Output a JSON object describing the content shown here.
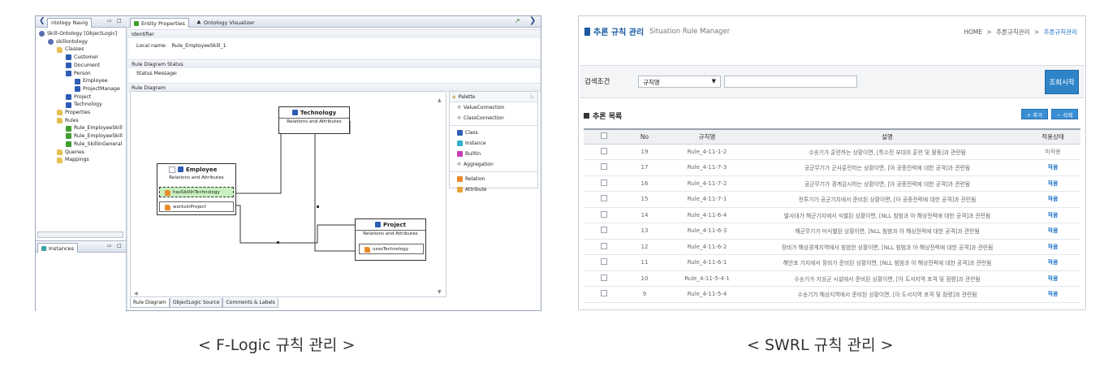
{
  "left": {
    "nav_tab": "ntology Navig",
    "entity_tab": "Entity Properties",
    "visualizer_tab": "Ontology Visualizer",
    "tree": [
      {
        "label": "Skill-Ontology [ObjectLogic]",
        "icon": "ontology-icon",
        "level": 0
      },
      {
        "label": "skillontology",
        "icon": "namespace-icon",
        "level": 1
      },
      {
        "label": "Classes",
        "icon": "folder-icon",
        "level": 2
      },
      {
        "label": "Customer",
        "icon": "class-icon",
        "level": 3
      },
      {
        "label": "Document",
        "icon": "class-icon",
        "level": 3
      },
      {
        "label": "Person",
        "icon": "class-icon",
        "level": 3
      },
      {
        "label": "Employee",
        "icon": "class-icon",
        "level": 4
      },
      {
        "label": "ProjectManage",
        "icon": "class-icon",
        "level": 4
      },
      {
        "label": "Project",
        "icon": "class-icon",
        "level": 3
      },
      {
        "label": "Technology",
        "icon": "class-icon",
        "level": 3
      },
      {
        "label": "Properties",
        "icon": "folder-icon",
        "level": 2
      },
      {
        "label": "Rules",
        "icon": "folder-icon",
        "level": 2
      },
      {
        "label": "Rule_EmployeeSkill",
        "icon": "rule-icon",
        "level": 3
      },
      {
        "label": "Rule_EmployeeSkill",
        "icon": "rule-icon",
        "level": 3
      },
      {
        "label": "Rule_SkillInGeneral",
        "icon": "rule-icon",
        "level": 3
      },
      {
        "label": "Queries",
        "icon": "folder-icon",
        "level": 2
      },
      {
        "label": "Mappings",
        "icon": "folder-icon",
        "level": 2
      }
    ],
    "instances_tab": "Instances",
    "identifier_header": "Identifier",
    "local_name_label": "Local name:",
    "local_name_value": "Rule_EmployeeSkill_1",
    "status_header": "Rule Diagram Status",
    "status_label": "Status Message:",
    "diagram_header": "Rule Diagram",
    "palette": {
      "title": "Palette",
      "items": [
        "ValueConnection",
        "ClassConnection",
        "Class",
        "Instance",
        "Builtin",
        "Aggregation",
        "Relation",
        "Attribute"
      ]
    },
    "nodes": {
      "technology": {
        "title": "Technology",
        "sub": "Relations and Attributes"
      },
      "employee": {
        "title": "Employee",
        "sub": "Relations and Attributes",
        "attrs": [
          "hasSkillInTechnology",
          "worksInProject"
        ]
      },
      "project": {
        "title": "Project",
        "sub": "Relations and Attributes",
        "attrs": [
          "usesTechnology"
        ]
      }
    },
    "bottom_tabs": [
      "Rule Diagram",
      "ObjectLogic Source",
      "Comments & Labels"
    ],
    "caption": "< F-Logic 규칙 관리 >"
  },
  "right": {
    "title": "추론 규칙 관리",
    "subtitle": "Situation Rule Manager",
    "breadcrumb": {
      "home": "HOME",
      "sep": ">",
      "mid": "추론규칙관리",
      "current": "추론규칙관리"
    },
    "search": {
      "label": "검색조건",
      "select_value": "규칙명",
      "button": "조회시작"
    },
    "list_title": "추론 목록",
    "add_btn": "+ 추가",
    "del_btn": "− 삭제",
    "columns": [
      "No",
      "규칙명",
      "설명",
      "적용상태"
    ],
    "rows": [
      {
        "no": "19",
        "name": "Rule_4-11-1-2",
        "desc": "수송기가 훈련하는 상황이면, [특수전 부대의 훈련 및 활동]과 관련됨",
        "status": "미적용"
      },
      {
        "no": "17",
        "name": "Rule_4-11-7-3",
        "desc": "공군무기가 군사훈련하는 상황이면, [아 공중전력에 대한 공격]과 관련됨",
        "status": "적용"
      },
      {
        "no": "16",
        "name": "Rule_4-11-7-2",
        "desc": "공군무기가 경계감시하는 상황이면, [아 공중전력에 대한 공격]과 관련됨",
        "status": "적용"
      },
      {
        "no": "15",
        "name": "Rule_4-11-7-1",
        "desc": "전투기가 공군기지에서 준비된 상황이면, [아 공중전력에 대한 공격]과 관련됨",
        "status": "적용"
      },
      {
        "no": "14",
        "name": "Rule_4-11-6-4",
        "desc": "발사대가 해군기지에서 식별된 상황이면, [NLL 침범과 아 해상전력에 대한 공격]과 관련됨",
        "status": "적용"
      },
      {
        "no": "13",
        "name": "Rule_4-11-6-3",
        "desc": "해군무기가 미식별된 상황이면, [NLL 침범과 아 해상전력에 대한 공격]과 관련됨",
        "status": "적용"
      },
      {
        "no": "12",
        "name": "Rule_4-11-6-2",
        "desc": "장비가 해상경계지역에서 침범한 상황이면, [NLL 침범과 아 해상전력에 대한 공격]과 관련됨",
        "status": "적용"
      },
      {
        "no": "11",
        "name": "Rule_4-11-6-1",
        "desc": "해안포 기지에서 장비가 준비된 상황이면, [NLL 침범과 아 해상전력에 대한 공격]과 관련됨",
        "status": "적용"
      },
      {
        "no": "10",
        "name": "Rule_4-11-5-4-1",
        "desc": "수송기가 지상군 시설에서 준비된 상황이면, [아 도서지역 포격 및 점령]과 관련됨",
        "status": "적용"
      },
      {
        "no": "9",
        "name": "Rule_4-11-5-4",
        "desc": "수송기가 해상지역에서 준비된 상황이면, [아 도서지역 포격 및 점령]과 관련됨",
        "status": "적용"
      }
    ],
    "caption": "< SWRL 규칙 관리 >"
  }
}
